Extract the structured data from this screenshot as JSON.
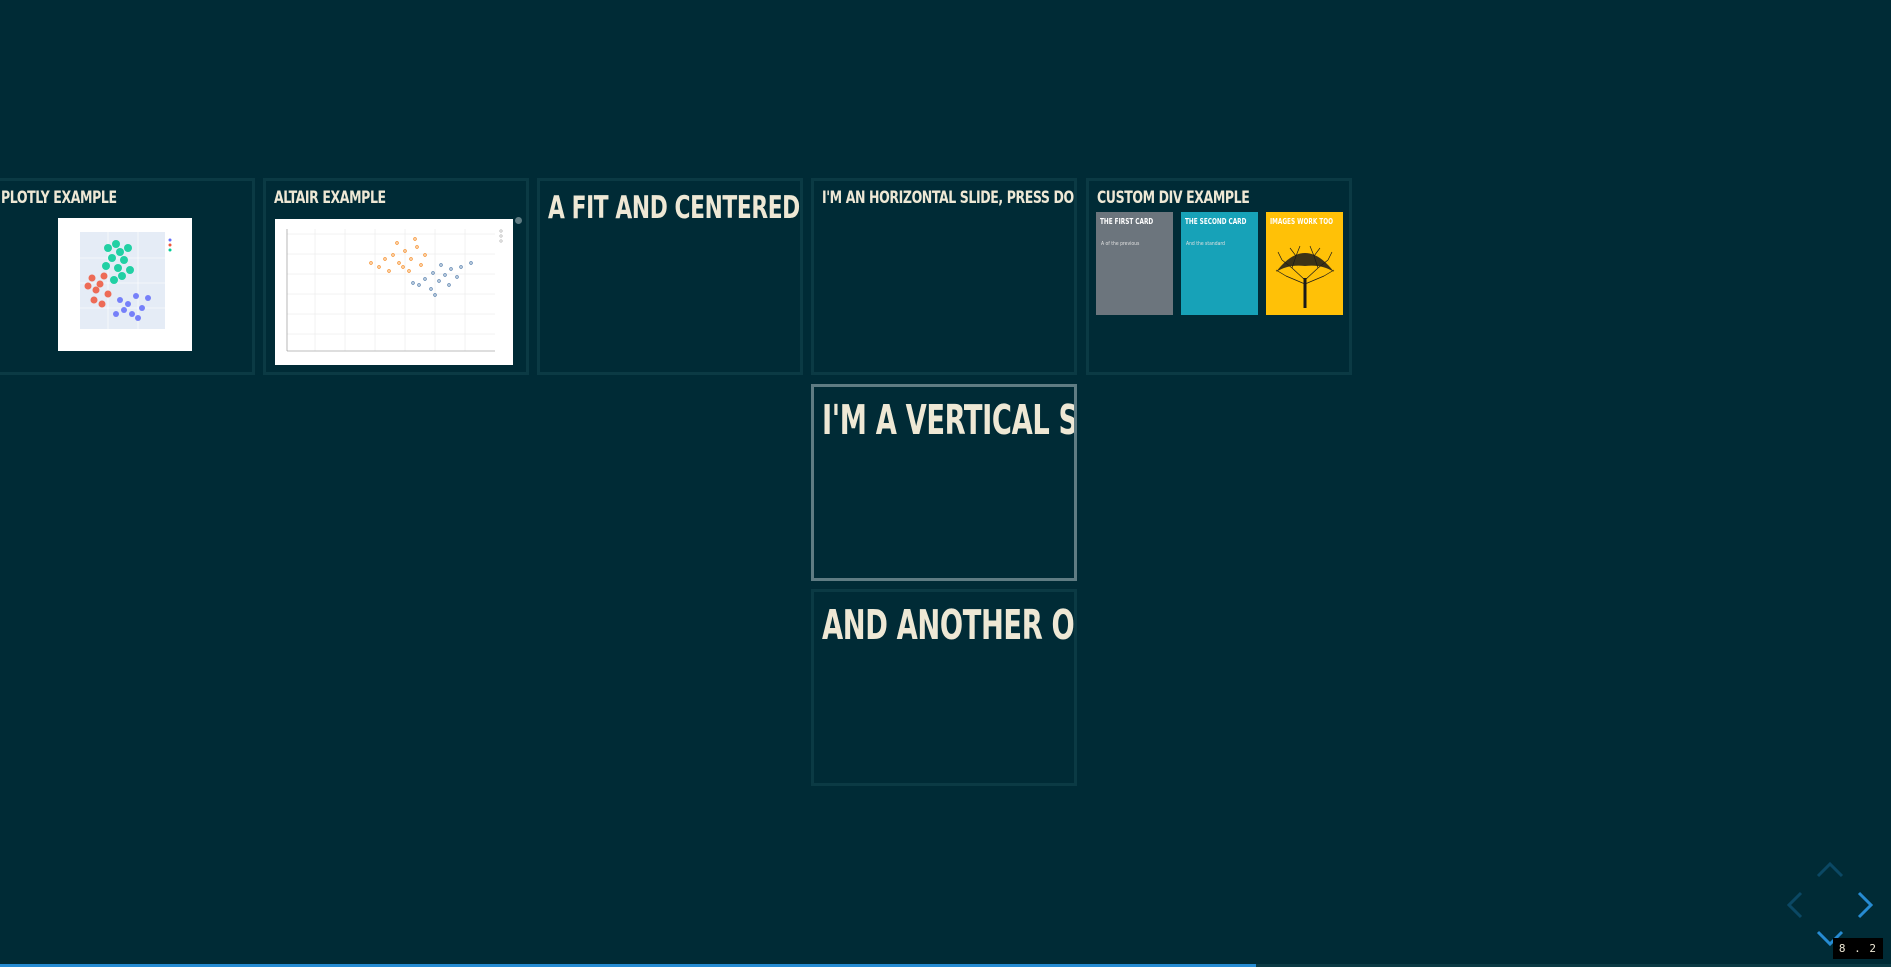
{
  "slides": {
    "plotly_title": "Plotly Example",
    "altair_title": "Altair Example",
    "fit_title": "A fit and centered text",
    "horizontal_title": "I'm an horizontal slide, press down",
    "custom_div_title": "Custom div example",
    "vertical_title": "I'm a vertical slide",
    "another_title": "And another one"
  },
  "cards": [
    {
      "title": "THE FIRST CARD",
      "text": "A of the previous",
      "color": "#6c757d"
    },
    {
      "title": "THE SECOND CARD",
      "text": "And the standard",
      "color": "#17a2b8"
    },
    {
      "title": "IMAGES WORK TOO",
      "text": "",
      "color": "#ffc107"
    }
  ],
  "controls": {
    "up_icon": "chevron-up-icon",
    "down_icon": "chevron-down-icon",
    "left_icon": "chevron-left-icon",
    "right_icon": "chevron-right-icon",
    "accent_color": "#268bd2"
  },
  "progress": {
    "fraction": 0.664
  },
  "slide_number": "8 . 2"
}
